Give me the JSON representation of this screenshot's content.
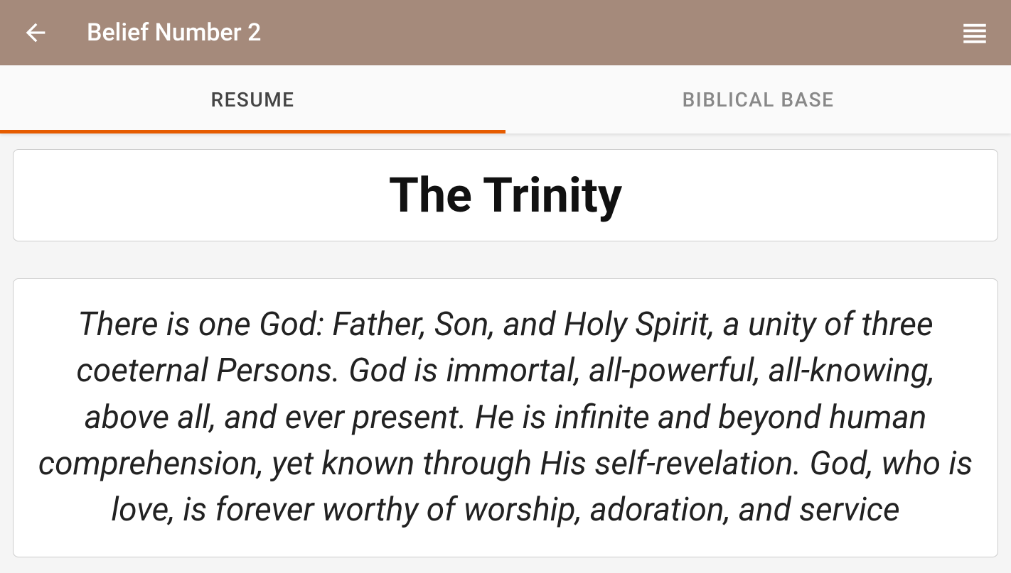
{
  "header": {
    "title": "Belief Number 2"
  },
  "tabs": {
    "resume": "RESUME",
    "biblical_base": "BIBLICAL BASE"
  },
  "content": {
    "title": "The Trinity",
    "description": "There is one God: Father, Son, and Holy Spirit, a unity of three coeternal Persons. God is immortal, all-powerful, all-knowing, above all, and ever present. He is infinite and beyond human comprehension, yet known through His self-revelation. God, who is love, is forever worthy of worship, adoration, and service"
  }
}
